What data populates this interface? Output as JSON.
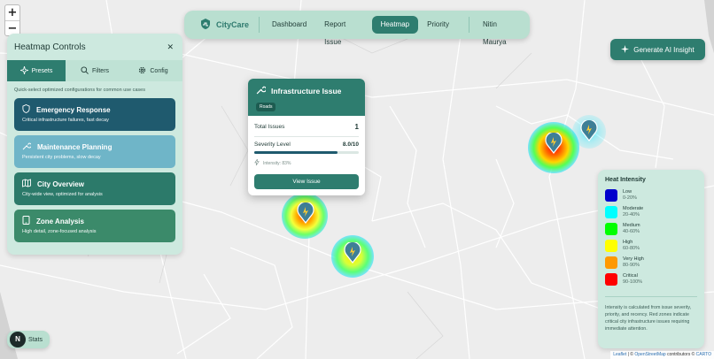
{
  "map": {
    "zoom_in": "+",
    "zoom_out": "−",
    "attribution": {
      "leaflet": "Leaflet",
      "separator": " | © ",
      "osm": "OpenStreetMap",
      "contributors": " contributors © ",
      "carto": "CARTO"
    }
  },
  "nav": {
    "brand": "CityCare",
    "items": [
      "Dashboard",
      "Report Issue",
      "Heatmap",
      "Priority"
    ],
    "active": "Heatmap",
    "user": "Nitin Maurya"
  },
  "ai_button": {
    "label": "Generate AI Insight",
    "icon": "sparkle-icon"
  },
  "controls": {
    "title": "Heatmap Controls",
    "close": "✕",
    "tabs": [
      {
        "label": "Presets",
        "icon": "presets-icon"
      },
      {
        "label": "Filters",
        "icon": "search-icon"
      },
      {
        "label": "Config",
        "icon": "gear-icon"
      }
    ],
    "description": "Quick-select optimized configurations for common use cases",
    "presets": [
      {
        "title": "Emergency Response",
        "subtitle": "Critical infrastructure failures, fast decay",
        "icon": "shield-icon",
        "color": "#1f5a6e"
      },
      {
        "title": "Maintenance Planning",
        "subtitle": "Persistent city problems, slow decay",
        "icon": "wrench-icon",
        "color": "#6fb5c8"
      },
      {
        "title": "City Overview",
        "subtitle": "City-wide view, optimized for analysis",
        "icon": "map-icon",
        "color": "#2c7a6a"
      },
      {
        "title": "Zone Analysis",
        "subtitle": "High detail, zone-focused analysis",
        "icon": "tablet-icon",
        "color": "#3b8a6a"
      }
    ]
  },
  "popup": {
    "title": "Infrastructure Issue",
    "tag": "Roads",
    "total_label": "Total Issues",
    "total_value": "1",
    "severity_label": "Severity Level",
    "severity_value": "8.0/10",
    "severity_fraction": 0.8,
    "intensity": "Intensity: 83%",
    "button": "View Issue"
  },
  "legend": {
    "title": "Heat Intensity",
    "items": [
      {
        "label": "Low",
        "range": "0-20%",
        "color": "#0000cc"
      },
      {
        "label": "Moderate",
        "range": "20-40%",
        "color": "#00ffff"
      },
      {
        "label": "Medium",
        "range": "40-60%",
        "color": "#00ff00"
      },
      {
        "label": "High",
        "range": "60-80%",
        "color": "#ffff00"
      },
      {
        "label": "Very High",
        "range": "80-90%",
        "color": "#ff9900"
      },
      {
        "label": "Critical",
        "range": "90-100%",
        "color": "#ff0000"
      }
    ],
    "note": "Intensity is calculated from issue severity, priority, and recency. Red zones indicate critical city infrastructure issues requiring immediate attention."
  },
  "stats": {
    "badge": "N",
    "label": "Stats"
  }
}
